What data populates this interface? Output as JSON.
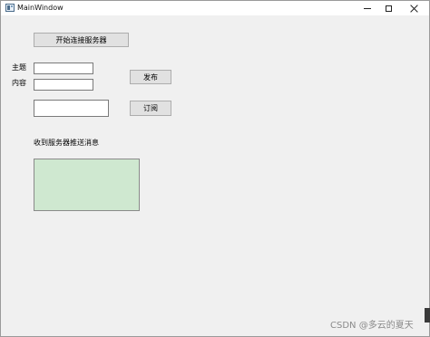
{
  "window": {
    "title": "MainWindow"
  },
  "controls": {
    "connect_button": "开始连接服务器",
    "topic_label": "主题",
    "content_label": "内容",
    "topic_value": "",
    "content_value": "",
    "publish_button": "发布",
    "subscribe_value": "",
    "subscribe_button": "订阅",
    "received_label": "收到服务器推送消息",
    "received_messages": ""
  },
  "colors": {
    "message_box_background": "#cfe8d0",
    "button_background": "#e1e1e1",
    "window_background": "#f0f0f0"
  },
  "watermark": "CSDN @多云的夏天"
}
